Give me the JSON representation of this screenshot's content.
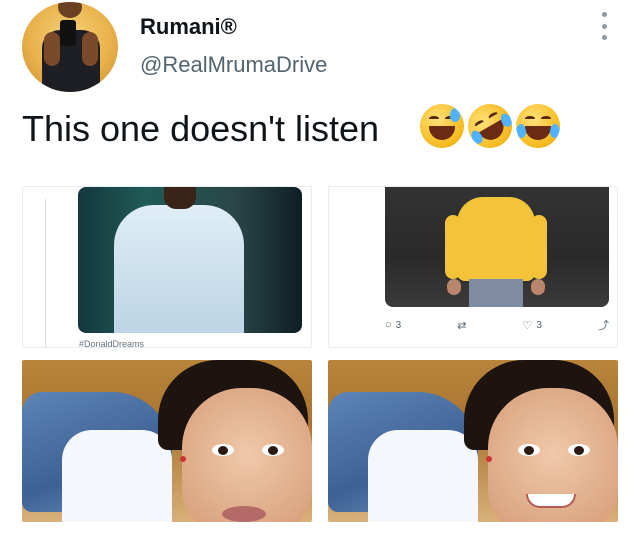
{
  "tweet": {
    "display_name": "Rumani®",
    "handle": "@RealMrumaDrive",
    "text": "This one doesn't listen",
    "emojis": [
      "grinning-sweat-emoji",
      "rolling-on-floor-laughing-emoji",
      "tears-of-joy-emoji"
    ]
  },
  "media": {
    "top_left": {
      "caption": "#DonaldDreams"
    },
    "top_right": {
      "actions": {
        "reply_count": "3",
        "like_count": "3"
      }
    }
  },
  "colors": {
    "text": "#0f1419",
    "secondary_text": "#536471",
    "background": "#ffffff"
  }
}
